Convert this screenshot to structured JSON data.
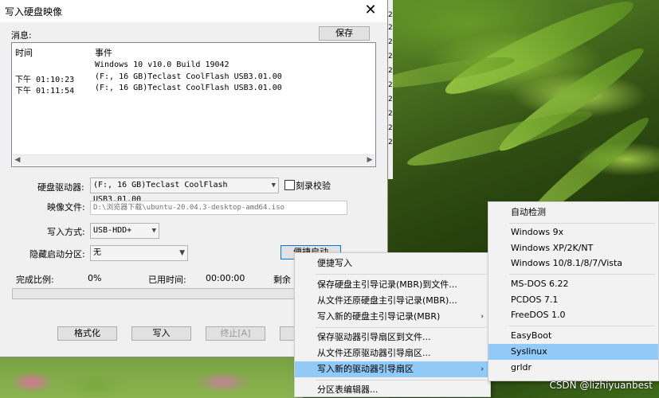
{
  "dialog": {
    "title": "写入硬盘映像",
    "close_glyph": "✕",
    "messages_label": "消息:",
    "save_button": "保存",
    "log_headers": [
      "时间",
      "事件"
    ],
    "log_rows": [
      {
        "time": "",
        "event": "Windows 10 v10.0 Build 19042"
      },
      {
        "time": "下午 01:10:23",
        "event": "(F:, 16 GB)Teclast CoolFlash USB3.01.00"
      },
      {
        "time": "下午 01:11:54",
        "event": "(F:, 16 GB)Teclast CoolFlash USB3.01.00"
      }
    ],
    "drive_label": "硬盘驱动器:",
    "drive_value": "(F:, 16 GB)Teclast CoolFlash USB3.01.00",
    "verify_label": "刻录校验",
    "image_label": "映像文件:",
    "image_value": "D:\\浏览器下载\\ubuntu-20.04.3-desktop-amd64.iso",
    "write_mode_label": "写入方式:",
    "write_mode_value": "USB-HDD+",
    "hidden_partition_label": "隐藏启动分区:",
    "hidden_partition_value": "无",
    "quick_boot_button": "便捷启动",
    "completion_label": "完成比例:",
    "completion_value": "0%",
    "elapsed_label": "已用时间:",
    "elapsed_value": "00:00:00",
    "remaining_label": "剩余",
    "progress_fraction": 0,
    "format_button": "格式化",
    "write_button": "写入",
    "stop_button": "终止[A]",
    "strip_digits": [
      "2",
      "2",
      "2",
      "2",
      "2",
      "2",
      "2",
      "2",
      "2",
      "2"
    ]
  },
  "menu_main": {
    "items": [
      {
        "label": "便捷写入",
        "submenu": false,
        "highlighted": false
      },
      {
        "label": "保存硬盘主引导记录(MBR)到文件...",
        "submenu": false,
        "highlighted": false
      },
      {
        "label": "从文件还原硬盘主引导记录(MBR)...",
        "submenu": false,
        "highlighted": false
      },
      {
        "label": "写入新的硬盘主引导记录(MBR)",
        "submenu": true,
        "highlighted": false
      },
      {
        "label": "保存驱动器引导扇区到文件...",
        "submenu": false,
        "highlighted": false
      },
      {
        "label": "从文件还原驱动器引导扇区...",
        "submenu": false,
        "highlighted": false
      },
      {
        "label": "写入新的驱动器引导扇区",
        "submenu": true,
        "highlighted": true
      },
      {
        "label": "分区表编辑器...",
        "submenu": false,
        "highlighted": false
      }
    ],
    "submenu_arrow": "›"
  },
  "menu_sub": {
    "items": [
      {
        "label": "自动检测",
        "highlighted": false
      },
      {
        "label": "Windows 9x",
        "highlighted": false
      },
      {
        "label": "Windows XP/2K/NT",
        "highlighted": false
      },
      {
        "label": "Windows 10/8.1/8/7/Vista",
        "highlighted": false
      },
      {
        "label": "MS-DOS 6.22",
        "highlighted": false
      },
      {
        "label": "PCDOS 7.1",
        "highlighted": false
      },
      {
        "label": "FreeDOS 1.0",
        "highlighted": false
      },
      {
        "label": "EasyBoot",
        "highlighted": false
      },
      {
        "label": "Syslinux",
        "highlighted": true
      },
      {
        "label": "grldr",
        "highlighted": false
      }
    ]
  },
  "watermark": "CSDN @lizhiyuanbest",
  "colors": {
    "highlight": "#91c9f7",
    "dialog_bg": "#f0f0f0"
  }
}
